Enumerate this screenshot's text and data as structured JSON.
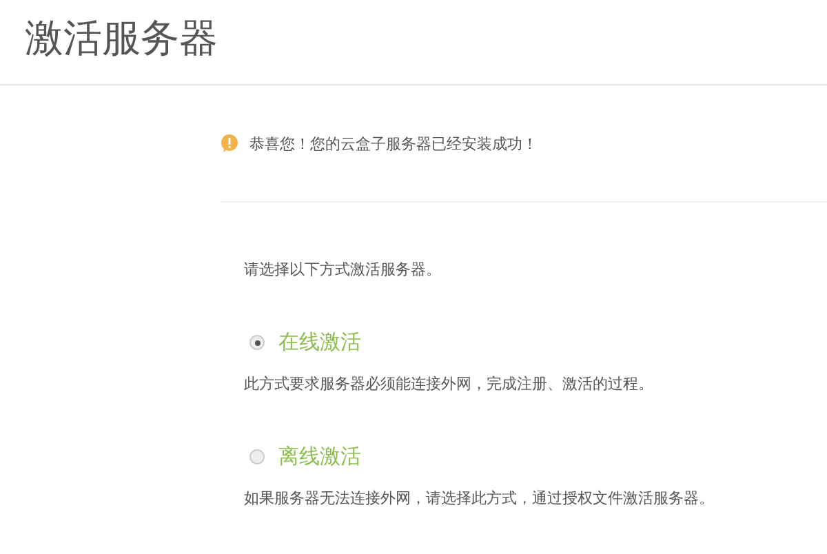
{
  "page_title": "激活服务器",
  "notice": {
    "text": "恭喜您！您的云盒子服务器已经安装成功！"
  },
  "prompt": "请选择以下方式激活服务器。",
  "options": [
    {
      "label": "在线激活",
      "selected": true,
      "description": "此方式要求服务器必须能连接外网，完成注册、激活的过程。"
    },
    {
      "label": "离线激活",
      "selected": false,
      "description": "如果服务器无法连接外网，请选择此方式，通过授权文件激活服务器。"
    }
  ]
}
